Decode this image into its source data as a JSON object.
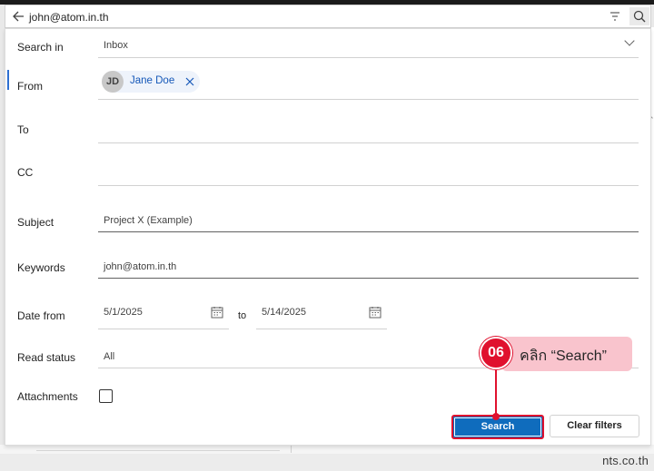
{
  "search_bar": {
    "query": "john@atom.in.th",
    "back_icon": "arrow-left-icon",
    "filter_icon": "filter-icon",
    "search_icon": "search-icon"
  },
  "form": {
    "search_in": {
      "label": "Search in",
      "value": "Inbox"
    },
    "from": {
      "label": "From",
      "chip": {
        "initials": "JD",
        "name": "Jane Doe"
      }
    },
    "to": {
      "label": "To",
      "value": ""
    },
    "cc": {
      "label": "CC",
      "value": ""
    },
    "subject": {
      "label": "Subject",
      "value": "Project X (Example)"
    },
    "keywords": {
      "label": "Keywords",
      "value": "john@atom.in.th"
    },
    "date": {
      "label": "Date from",
      "from": "5/1/2025",
      "to_label": "to",
      "to": "5/14/2025"
    },
    "read_status": {
      "label": "Read status",
      "value": "All"
    },
    "attachments": {
      "label": "Attachments",
      "checked": false
    }
  },
  "buttons": {
    "search": "Search",
    "clear": "Clear filters"
  },
  "callout": {
    "number": "06",
    "text": "คลิก “Search”"
  },
  "watermark": "nts.co.th",
  "colors": {
    "accent": "#0f6cbd",
    "highlight": "#e0112e",
    "callout_bg": "#f9c4cd"
  }
}
